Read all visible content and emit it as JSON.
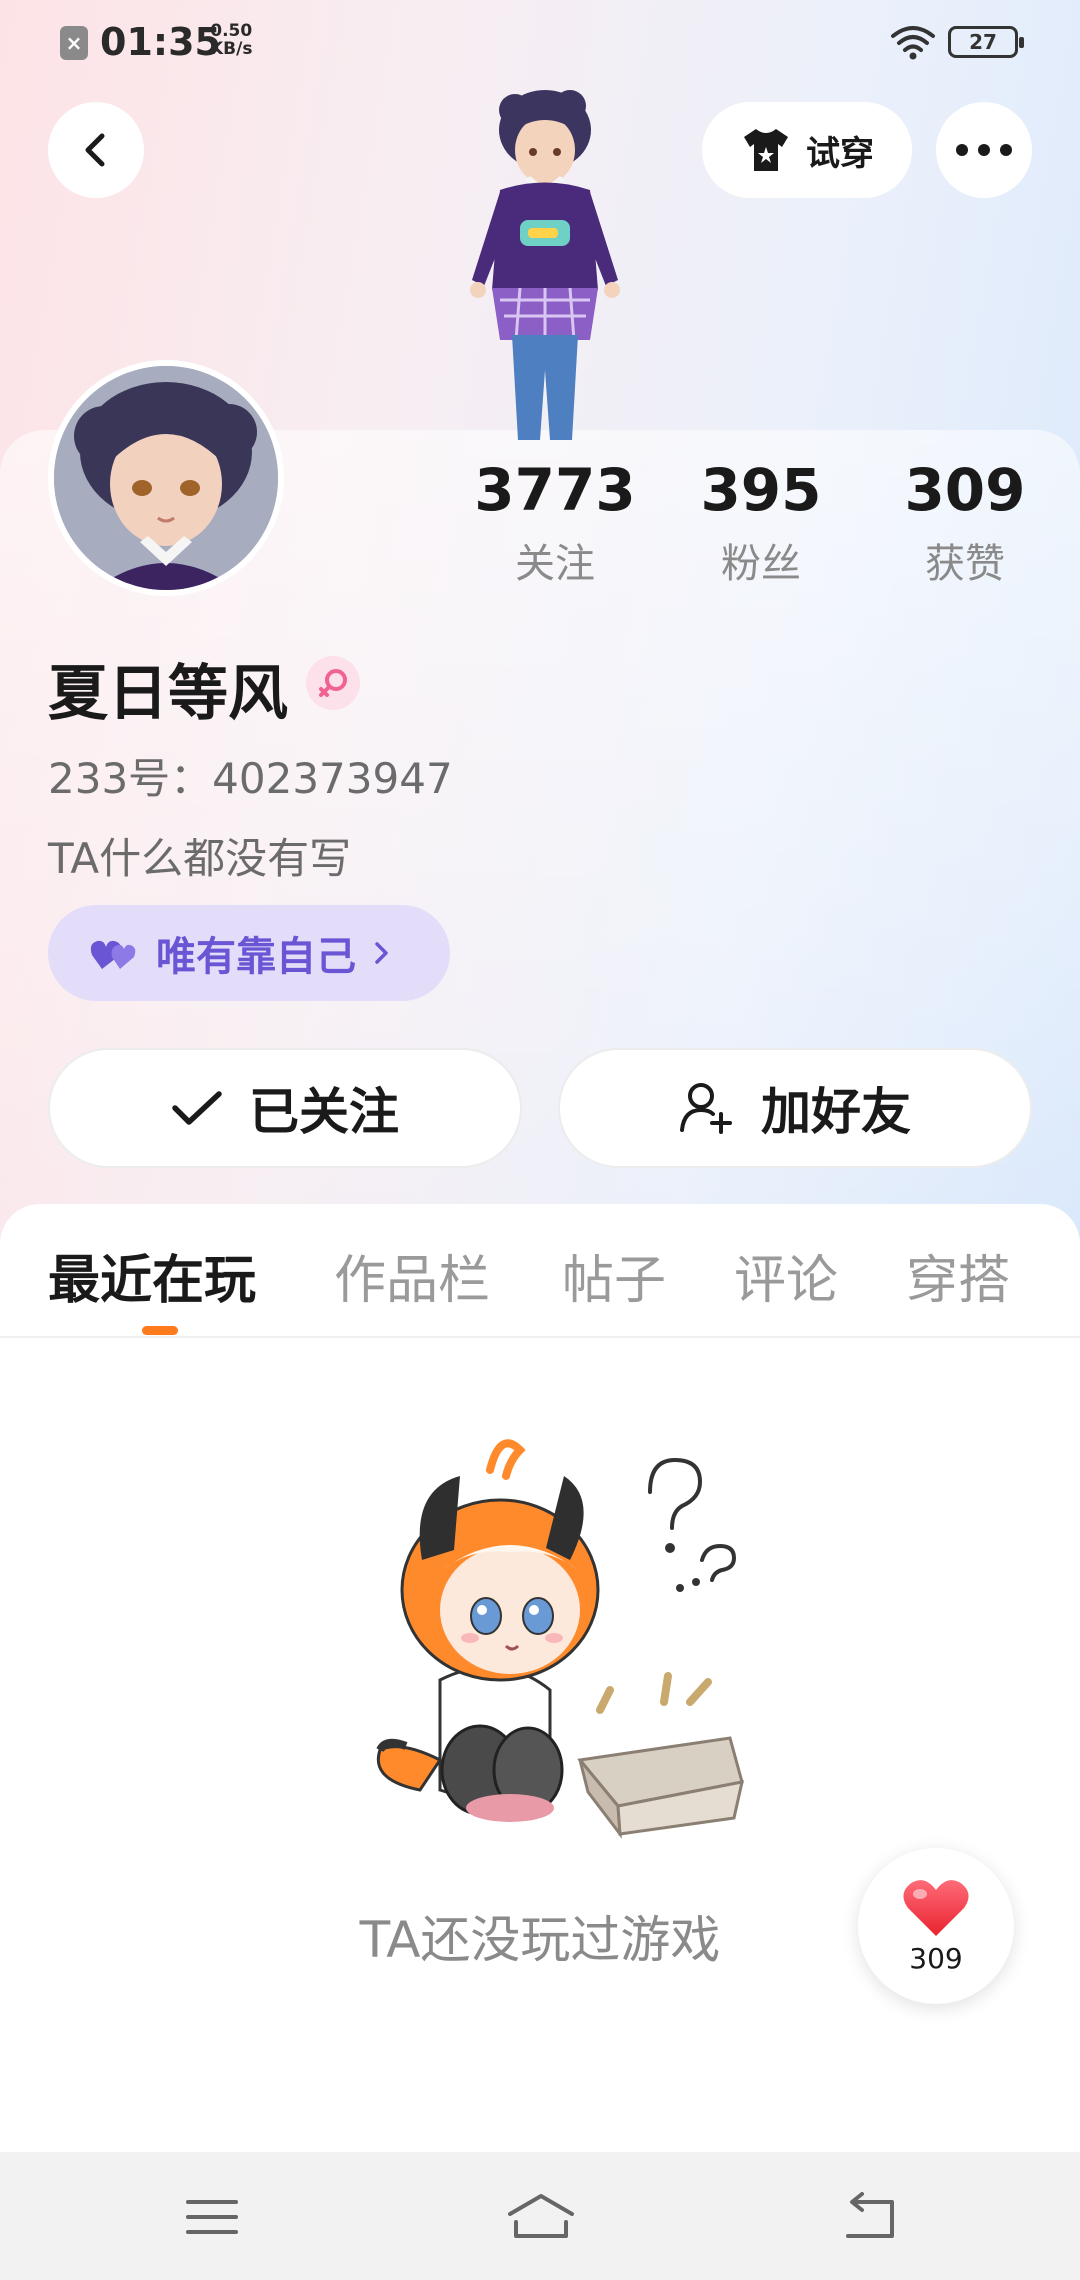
{
  "status_bar": {
    "time": "01:35",
    "speed_value": "0.50",
    "speed_unit": "KB/s",
    "battery": "27"
  },
  "header": {
    "try_on_label": "试穿"
  },
  "profile": {
    "name": "夏日等风",
    "uid": "233号：402373947",
    "bio": "TA什么都没有写",
    "tag_label": "唯有靠自己",
    "stats": [
      {
        "value": "3773",
        "label": "关注"
      },
      {
        "value": "395",
        "label": "粉丝"
      },
      {
        "value": "309",
        "label": "获赞"
      }
    ]
  },
  "actions": {
    "followed_label": "已关注",
    "add_friend_label": "加好友"
  },
  "tabs": [
    {
      "label": "最近在玩",
      "active": true
    },
    {
      "label": "作品栏",
      "active": false
    },
    {
      "label": "帖子",
      "active": false
    },
    {
      "label": "评论",
      "active": false
    },
    {
      "label": "穿搭",
      "active": false
    }
  ],
  "empty_state": {
    "message": "TA还没玩过游戏"
  },
  "like_fab": {
    "count": "309"
  },
  "colors": {
    "accent_orange": "#ff7a1a",
    "tag_purple": "#6a55d4",
    "tag_bg": "#e4ddf9",
    "like_red": "#f23a4a"
  }
}
